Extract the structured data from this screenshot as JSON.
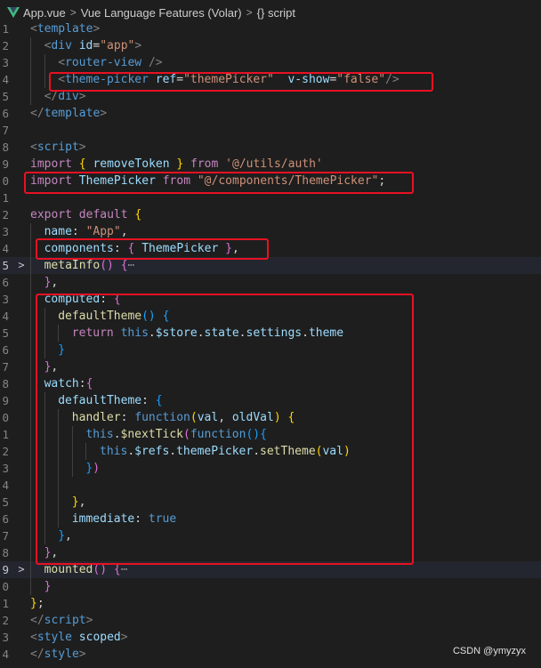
{
  "breadcrumb": {
    "items": [
      "App.vue",
      "Vue Language Features (Volar)",
      "{} script"
    ],
    "separator": ">"
  },
  "colors": {
    "background": "#1e1e1e",
    "highlight_box": "#e81123",
    "tag": "#808080",
    "keyword": "#569cd6",
    "attribute": "#9cdcfe",
    "string": "#ce9178",
    "control": "#c586c0",
    "function": "#dcdcaa",
    "class": "#4ec9b0",
    "bracket_level1": "#ffd700",
    "bracket_level2": "#da70d6",
    "bracket_level3": "#179fff"
  },
  "highlighted_lines": [
    "<theme-picker ref=\"themePicker\"  v-show=\"false\"/>",
    "import ThemePicker from \"@/components/ThemePicker\";",
    "components: { ThemePicker },",
    "computed / watch block"
  ],
  "editor": {
    "lines": [
      {
        "ln": "1",
        "fold": "",
        "tokens": [
          [
            "tag",
            "<"
          ],
          [
            "kw",
            "template"
          ],
          [
            "tag",
            ">"
          ]
        ]
      },
      {
        "ln": "2",
        "fold": "",
        "tokens": [
          [
            "tag",
            "<"
          ],
          [
            "kw",
            "div"
          ],
          [
            "plain",
            " "
          ],
          [
            "attr",
            "id"
          ],
          [
            "plain",
            "="
          ],
          [
            "str",
            "\"app\""
          ],
          [
            "tag",
            ">"
          ]
        ]
      },
      {
        "ln": "3",
        "fold": "",
        "tokens": [
          [
            "tag",
            "<"
          ],
          [
            "kw",
            "router-view"
          ],
          [
            "plain",
            " "
          ],
          [
            "tag",
            "/>"
          ]
        ]
      },
      {
        "ln": "4",
        "fold": "",
        "tokens": [
          [
            "tag",
            "<"
          ],
          [
            "kw",
            "theme-picker"
          ],
          [
            "plain",
            " "
          ],
          [
            "attr",
            "ref"
          ],
          [
            "plain",
            "="
          ],
          [
            "str",
            "\"themePicker\""
          ],
          [
            "plain",
            "  "
          ],
          [
            "attr",
            "v-show"
          ],
          [
            "plain",
            "="
          ],
          [
            "str",
            "\"false\""
          ],
          [
            "tag",
            "/>"
          ]
        ]
      },
      {
        "ln": "5",
        "fold": "",
        "tokens": [
          [
            "tag",
            "</"
          ],
          [
            "kw",
            "div"
          ],
          [
            "tag",
            ">"
          ]
        ]
      },
      {
        "ln": "6",
        "fold": "",
        "tokens": [
          [
            "tag",
            "</"
          ],
          [
            "kw",
            "template"
          ],
          [
            "tag",
            ">"
          ]
        ]
      },
      {
        "ln": "7",
        "fold": "",
        "tokens": []
      },
      {
        "ln": "8",
        "fold": "",
        "tokens": [
          [
            "tag",
            "<"
          ],
          [
            "kw",
            "script"
          ],
          [
            "tag",
            ">"
          ]
        ]
      },
      {
        "ln": "9",
        "fold": "",
        "tokens": [
          [
            "ctl",
            "import"
          ],
          [
            "plain",
            " "
          ],
          [
            "b1",
            "{"
          ],
          [
            "plain",
            " "
          ],
          [
            "var",
            "removeToken"
          ],
          [
            "plain",
            " "
          ],
          [
            "b1",
            "}"
          ],
          [
            "plain",
            " "
          ],
          [
            "ctl",
            "from"
          ],
          [
            "plain",
            " "
          ],
          [
            "str",
            "'@/utils/auth'"
          ]
        ]
      },
      {
        "ln": "0",
        "fold": "",
        "tokens": [
          [
            "ctl",
            "import"
          ],
          [
            "plain",
            " "
          ],
          [
            "var",
            "ThemePicker"
          ],
          [
            "plain",
            " "
          ],
          [
            "ctl",
            "from"
          ],
          [
            "plain",
            " "
          ],
          [
            "str",
            "\"@/components/ThemePicker\""
          ],
          [
            "plain",
            ";"
          ]
        ]
      },
      {
        "ln": "1",
        "fold": "",
        "tokens": []
      },
      {
        "ln": "2",
        "fold": "",
        "tokens": [
          [
            "ctl",
            "export"
          ],
          [
            "plain",
            " "
          ],
          [
            "ctl",
            "default"
          ],
          [
            "plain",
            " "
          ],
          [
            "b1",
            "{"
          ]
        ]
      },
      {
        "ln": "3",
        "fold": "",
        "tokens": [
          [
            "var",
            "name"
          ],
          [
            "plain",
            ": "
          ],
          [
            "str",
            "\"App\""
          ],
          [
            "plain",
            ","
          ]
        ]
      },
      {
        "ln": "4",
        "fold": "",
        "tokens": [
          [
            "var",
            "components"
          ],
          [
            "plain",
            ": "
          ],
          [
            "b2",
            "{"
          ],
          [
            "plain",
            " "
          ],
          [
            "var",
            "ThemePicker"
          ],
          [
            "plain",
            " "
          ],
          [
            "b2",
            "}"
          ],
          [
            "plain",
            ","
          ]
        ]
      },
      {
        "ln": "5",
        "fold": ">",
        "tokens": [
          [
            "fn",
            "metaInfo"
          ],
          [
            "b2",
            "()"
          ],
          [
            "plain",
            " "
          ],
          [
            "b2",
            "{"
          ],
          [
            "fold",
            "⋯"
          ]
        ]
      },
      {
        "ln": "6",
        "fold": "",
        "tokens": [
          [
            "b2",
            "}"
          ],
          [
            "plain",
            ","
          ]
        ]
      },
      {
        "ln": "3",
        "fold": "",
        "tokens": [
          [
            "var",
            "computed"
          ],
          [
            "plain",
            ": "
          ],
          [
            "b2",
            "{"
          ]
        ]
      },
      {
        "ln": "4",
        "fold": "",
        "tokens": [
          [
            "fn",
            "defaultTheme"
          ],
          [
            "b3",
            "()"
          ],
          [
            "plain",
            " "
          ],
          [
            "b3",
            "{"
          ]
        ]
      },
      {
        "ln": "5",
        "fold": "",
        "tokens": [
          [
            "ctl",
            "return"
          ],
          [
            "plain",
            " "
          ],
          [
            "kw",
            "this"
          ],
          [
            "plain",
            "."
          ],
          [
            "var",
            "$store"
          ],
          [
            "plain",
            "."
          ],
          [
            "var",
            "state"
          ],
          [
            "plain",
            "."
          ],
          [
            "var",
            "settings"
          ],
          [
            "plain",
            "."
          ],
          [
            "var",
            "theme"
          ]
        ]
      },
      {
        "ln": "6",
        "fold": "",
        "tokens": [
          [
            "b3",
            "}"
          ]
        ]
      },
      {
        "ln": "7",
        "fold": "",
        "tokens": [
          [
            "b2",
            "}"
          ],
          [
            "plain",
            ","
          ]
        ]
      },
      {
        "ln": "8",
        "fold": "",
        "tokens": [
          [
            "var",
            "watch"
          ],
          [
            "plain",
            ":"
          ],
          [
            "b2",
            "{"
          ]
        ]
      },
      {
        "ln": "9",
        "fold": "",
        "tokens": [
          [
            "var",
            "defaultTheme"
          ],
          [
            "plain",
            ": "
          ],
          [
            "b3",
            "{"
          ]
        ]
      },
      {
        "ln": "0",
        "fold": "",
        "tokens": [
          [
            "fn",
            "handler"
          ],
          [
            "plain",
            ": "
          ],
          [
            "kw",
            "function"
          ],
          [
            "b1",
            "("
          ],
          [
            "var",
            "val"
          ],
          [
            "plain",
            ", "
          ],
          [
            "var",
            "oldVal"
          ],
          [
            "b1",
            ")"
          ],
          [
            "plain",
            " "
          ],
          [
            "b1",
            "{"
          ]
        ]
      },
      {
        "ln": "1",
        "fold": "",
        "tokens": [
          [
            "kw",
            "this"
          ],
          [
            "plain",
            "."
          ],
          [
            "fn",
            "$nextTick"
          ],
          [
            "b2",
            "("
          ],
          [
            "kw",
            "function"
          ],
          [
            "b3",
            "()"
          ],
          [
            "b3",
            "{"
          ]
        ]
      },
      {
        "ln": "2",
        "fold": "",
        "tokens": [
          [
            "kw",
            "this"
          ],
          [
            "plain",
            "."
          ],
          [
            "var",
            "$refs"
          ],
          [
            "plain",
            "."
          ],
          [
            "var",
            "themePicker"
          ],
          [
            "plain",
            "."
          ],
          [
            "fn",
            "setTheme"
          ],
          [
            "b1",
            "("
          ],
          [
            "var",
            "val"
          ],
          [
            "b1",
            ")"
          ]
        ]
      },
      {
        "ln": "3",
        "fold": "",
        "tokens": [
          [
            "b3",
            "}"
          ],
          [
            "b2",
            ")"
          ]
        ]
      },
      {
        "ln": "4",
        "fold": "",
        "tokens": []
      },
      {
        "ln": "5",
        "fold": "",
        "tokens": [
          [
            "b1",
            "}"
          ],
          [
            "plain",
            ","
          ]
        ]
      },
      {
        "ln": "6",
        "fold": "",
        "tokens": [
          [
            "var",
            "immediate"
          ],
          [
            "plain",
            ": "
          ],
          [
            "kw",
            "true"
          ]
        ]
      },
      {
        "ln": "7",
        "fold": "",
        "tokens": [
          [
            "b3",
            "}"
          ],
          [
            "plain",
            ","
          ]
        ]
      },
      {
        "ln": "8",
        "fold": "",
        "tokens": [
          [
            "b2",
            "}"
          ],
          [
            "plain",
            ","
          ]
        ]
      },
      {
        "ln": "9",
        "fold": ">",
        "tokens": [
          [
            "fn",
            "mounted"
          ],
          [
            "b2",
            "()"
          ],
          [
            "plain",
            " "
          ],
          [
            "b2",
            "{"
          ],
          [
            "fold",
            "⋯"
          ]
        ]
      },
      {
        "ln": "0",
        "fold": "",
        "tokens": [
          [
            "b2",
            "}"
          ]
        ]
      },
      {
        "ln": "1",
        "fold": "",
        "tokens": [
          [
            "b1",
            "}"
          ],
          [
            "plain",
            ";"
          ]
        ]
      },
      {
        "ln": "2",
        "fold": "",
        "tokens": [
          [
            "tag",
            "</"
          ],
          [
            "kw",
            "script"
          ],
          [
            "tag",
            ">"
          ]
        ]
      },
      {
        "ln": "3",
        "fold": "",
        "tokens": [
          [
            "tag",
            "<"
          ],
          [
            "kw",
            "style"
          ],
          [
            "plain",
            " "
          ],
          [
            "attr",
            "scoped"
          ],
          [
            "tag",
            ">"
          ]
        ]
      },
      {
        "ln": "4",
        "fold": "",
        "tokens": [
          [
            "tag",
            "</"
          ],
          [
            "kw",
            "style"
          ],
          [
            "tag",
            ">"
          ]
        ]
      }
    ]
  },
  "watermark": "CSDN @ymyzyx"
}
